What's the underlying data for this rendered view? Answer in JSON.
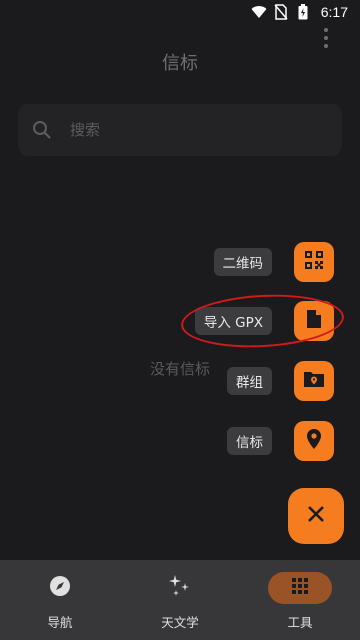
{
  "status_bar": {
    "time": "6:17"
  },
  "app_bar": {
    "title": "信标"
  },
  "search": {
    "placeholder": "搜索"
  },
  "empty_state": {
    "text": "没有信标"
  },
  "fab_menu": {
    "items": [
      {
        "label": "二维码",
        "icon": "qr-code-icon"
      },
      {
        "label": "导入 GPX",
        "icon": "file-icon"
      },
      {
        "label": "群组",
        "icon": "folder-location-icon"
      },
      {
        "label": "信标",
        "icon": "location-pin-icon"
      }
    ],
    "close_icon": "close-icon"
  },
  "bottom_nav": {
    "items": [
      {
        "label": "导航",
        "icon": "compass-icon",
        "active": false
      },
      {
        "label": "天文学",
        "icon": "sparkles-icon",
        "active": false
      },
      {
        "label": "工具",
        "icon": "grid-icon",
        "active": true
      }
    ]
  },
  "colors": {
    "background": "#1b1b1d",
    "accent": "#f57c1f",
    "nav_background": "#37373a",
    "nav_active_pill": "#9a5326",
    "highlight": "#d11a1a"
  }
}
